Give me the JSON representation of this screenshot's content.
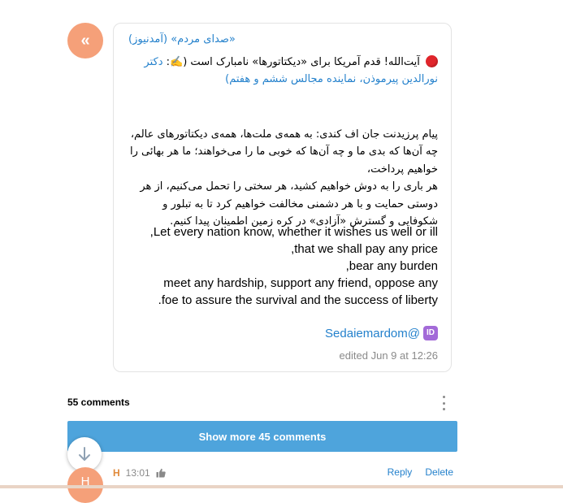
{
  "post": {
    "channel_avatar_glyph": "«",
    "channel_name": "«صدای مردم» (آمدنیوز)",
    "headline_text": "آیت‌الله! قدم آمریکا برای «دیکتاتورها» نامبارک است (",
    "headline_emoji": "✍️",
    "headline_close": ":",
    "headline_link": "دکتر نورالدین پیرموذن، نماینده مجالس ششم و هفتم)",
    "fa_paragraph": "پیام پرزیدنت جان اف کندی: به همه‌ی ملت‌ها، همه‌ی دیکتاتورهای عالم، چه آن‌ها که بدی ما و چه آن‌ها که خوبی ما را می‌خواهند؛ ما هر بهائی را خواهیم پرداخت،\nهر باری را به دوش خواهیم کشید، هر سختی را تحمل می‌کنیم، از هر دوستی حمایت و با هر دشمنی مخالفت خواهیم کرد تا به تبلور و شکوفایی و گسترش «آزادی» در کره زمین اطمینان پیدا کنیم.",
    "en_lines": [
      "Let every nation know, whether it wishes us well or ill,",
      "that we shall pay any price,",
      "bear any burden,",
      "meet any hardship, support any friend, oppose any",
      "foe to assure the survival and the success of liberty."
    ],
    "signature": "Sedaiemardom@",
    "signature_badge": "ID",
    "edited_label": "edited",
    "edited_time": "Jun 9 at 12:26"
  },
  "comments": {
    "count_label": "55 comments",
    "show_more_label": "Show more 45 comments",
    "first": {
      "avatar_letter": "H",
      "author": "H",
      "time": "13:01",
      "reply_label": "Reply",
      "delete_label": "Delete"
    }
  },
  "colors": {
    "accent": "#2481cc",
    "avatar": "#f5a079",
    "button": "#4ea4dc",
    "author": "#e08a3a"
  },
  "icons": {
    "post_status": "red-circle-icon",
    "scroll_down": "arrow-down-icon",
    "more": "kebab-menu-icon",
    "like": "thumbs-up-icon",
    "id_badge": "id-badge-icon"
  }
}
